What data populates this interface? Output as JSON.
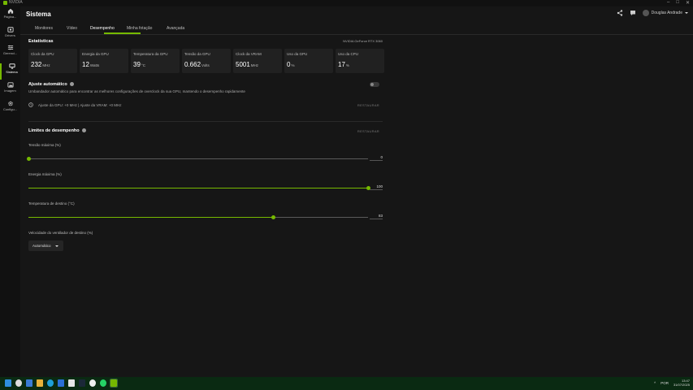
{
  "window": {
    "title": "NVIDIA",
    "brand_color": "#76b900"
  },
  "sidebar": {
    "items": [
      {
        "label": "Página...",
        "icon": "home-icon"
      },
      {
        "label": "Drivers",
        "icon": "drivers-icon"
      },
      {
        "label": "Gerenci...",
        "icon": "sliders-icon"
      },
      {
        "label": "Sistema",
        "icon": "monitor-icon",
        "active": true
      },
      {
        "label": "Imagem",
        "icon": "image-icon"
      },
      {
        "label": "Configu...",
        "icon": "gear-icon"
      }
    ]
  },
  "header": {
    "title": "Sistema",
    "user_name": "Douglas Andrade"
  },
  "tabs": [
    {
      "label": "Monitores"
    },
    {
      "label": "Vídeo"
    },
    {
      "label": "Desempenho",
      "active": true
    },
    {
      "label": "Minha fotação"
    },
    {
      "label": "Avançada"
    }
  ],
  "stats": {
    "title": "Estatísticas",
    "gpu_name": "NVIDIA GeForce RTX 3060",
    "cards": [
      {
        "label": "Clock da GPU",
        "value": "232",
        "unit": "MHz"
      },
      {
        "label": "Energia da GPU",
        "value": "12",
        "unit": "Watts"
      },
      {
        "label": "Temperatura da GPU",
        "value": "39",
        "unit": "°C"
      },
      {
        "label": "Tensão da GPU",
        "value": "0.662",
        "unit": "Volts"
      },
      {
        "label": "Clock da VRAM",
        "value": "5001",
        "unit": "MHz"
      },
      {
        "label": "Uso da GPU",
        "value": "0",
        "unit": "%"
      },
      {
        "label": "Uso da CPU",
        "value": "17",
        "unit": "%"
      }
    ]
  },
  "auto_tune": {
    "title": "Ajuste automático",
    "description": "Umbandador automático para encontrar as melhores configurações de overclock da sua GPU, mantendo o desempenho rapidamente",
    "enabled": false,
    "offsets_text": "Ajuste da GPU: +0 MHz   |   Ajuste da VRAM: +0 MHz",
    "action_label": "RESTAURAR"
  },
  "limits": {
    "title": "Limites de desempenho",
    "action_label": "RESTAURAR",
    "sliders": [
      {
        "label": "Tensão máxima (%)",
        "value": "0",
        "fraction": 0.0
      },
      {
        "label": "Energia máxima (%)",
        "value": "100",
        "fraction": 1.0
      },
      {
        "label": "Temperatura de destino (°C)",
        "value": "83",
        "fraction": 0.72
      }
    ],
    "fan": {
      "label": "Velocidade do ventilador de destino (%)",
      "selected": "Automático"
    }
  },
  "taskbar": {
    "language": "POR",
    "time": "13:47",
    "date": "31/07/2025"
  }
}
